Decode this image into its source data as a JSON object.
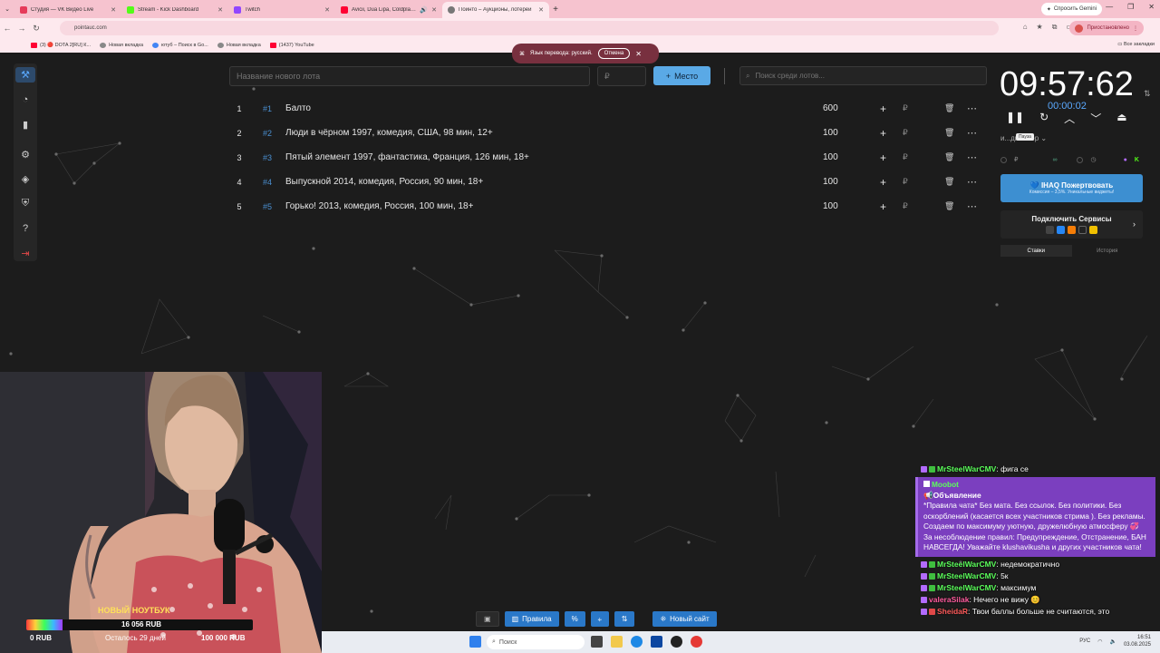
{
  "browser": {
    "tabs": [
      {
        "title": "Студия — VK Видео Live",
        "color": "#e63b5a",
        "active": false
      },
      {
        "title": "Stream - Kick Dashboard",
        "color": "#53fc18",
        "active": false
      },
      {
        "title": "Twitch",
        "color": "#9146ff",
        "active": false
      },
      {
        "title": "Avicii, Dua Lipa, Coldplay, M",
        "color": "#ff0033",
        "active": false
      },
      {
        "title": "Пойнто – Аукционы, лотереи",
        "color": "#777777",
        "active": true
      }
    ],
    "gemini_label": "Спросить Gemini",
    "url": "pointauc.com",
    "paused_label": "Приостановлено",
    "bookmarks": [
      "(3) 🔴 DOTA 2[RU] К...",
      "Новая вкладка",
      "ютуб – Поиск в Go...",
      "Новая вкладка",
      "(1437) YouTube"
    ],
    "all_bookmarks": "Все закладки"
  },
  "translate_popup": {
    "text": "Язык перевода: русский.",
    "cancel": "Отмена"
  },
  "auction": {
    "lot_name_placeholder": "Название нового лота",
    "price_placeholder": "₽",
    "add_place_label": "Место",
    "search_placeholder": "Поиск среди лотов...",
    "lots": [
      {
        "index": "1",
        "tag": "#1",
        "name": "Балто",
        "amount": "600"
      },
      {
        "index": "2",
        "tag": "#2",
        "name": "Люди в чёрном 1997, комедия, США, 98 мин, 12+",
        "amount": "100"
      },
      {
        "index": "3",
        "tag": "#3",
        "name": "Пятый элемент 1997, фантастика, Франция, 126 мин, 18+",
        "amount": "100"
      },
      {
        "index": "4",
        "tag": "#4",
        "name": "Выпускной 2014, комедия, Россия, 90 мин, 18+",
        "amount": "100"
      },
      {
        "index": "5",
        "tag": "#5",
        "name": "Горько! 2013, комедия, Россия, 100 мин, 18+",
        "amount": "100"
      }
    ],
    "currency": "₽"
  },
  "timer": {
    "main": "09:57:62",
    "sub": "00:00:02",
    "tooltip": "Пауза",
    "mode_label": "и...дия шер"
  },
  "right_panel": {
    "donate_title": "IHAQ Пожертвовать",
    "donate_sub": "Комиссия – 3,5%. Уникальные виджеты!",
    "services_title": "Подключить Сервисы",
    "tab_bets": "Ставки",
    "tab_history": "История"
  },
  "bottom_tools": {
    "rules": "Правила",
    "new_site": "Новый сайт"
  },
  "stream_overlay": {
    "new_laptop": "НОВЫЙ НОУТБУК",
    "progress_value": "16 056 RUB",
    "progress_fraction": 0.16,
    "start": "0 RUB",
    "days_left": "Осталось 29 дней",
    "goal": "100 000 RUB"
  },
  "chat": {
    "top_partial": {
      "user": "MrSteelWarCMV",
      "text": "фига се"
    },
    "announce_user": "Moobot",
    "announce_title": "Объявление",
    "announce_text": "*Правила чата* Без мата. Без ссылок. Без политики. Без оскорблений (касается всех участников стрима ). Без рекламы. Создаем по максимуму уютную, дружелюбную атмосферу 💞 За несоблюдение правил: Предупреждение, Отстранение, БАН НАВСЕГДА! Уважайте klushavikusha и других участников чата!",
    "messages": [
      {
        "user": "MrSteelWarCMV",
        "color": "#5bff5b",
        "text": "недемократично"
      },
      {
        "user": "MrSteelWarCMV",
        "color": "#5bff5b",
        "text": "5к"
      },
      {
        "user": "MrSteelWarCMV",
        "color": "#5bff5b",
        "text": "максимум"
      },
      {
        "user": "valeraSilak",
        "color": "#ff5b9e",
        "text": "Нечего не вижу 😊"
      },
      {
        "user": "SheidaR",
        "color": "#ff5b5b",
        "text": "Твои баллы больше не считаются, это"
      }
    ]
  },
  "taskbar": {
    "search_placeholder": "Поиск",
    "lang": "РУС",
    "time": "16:51",
    "date": "03.08.2025"
  }
}
